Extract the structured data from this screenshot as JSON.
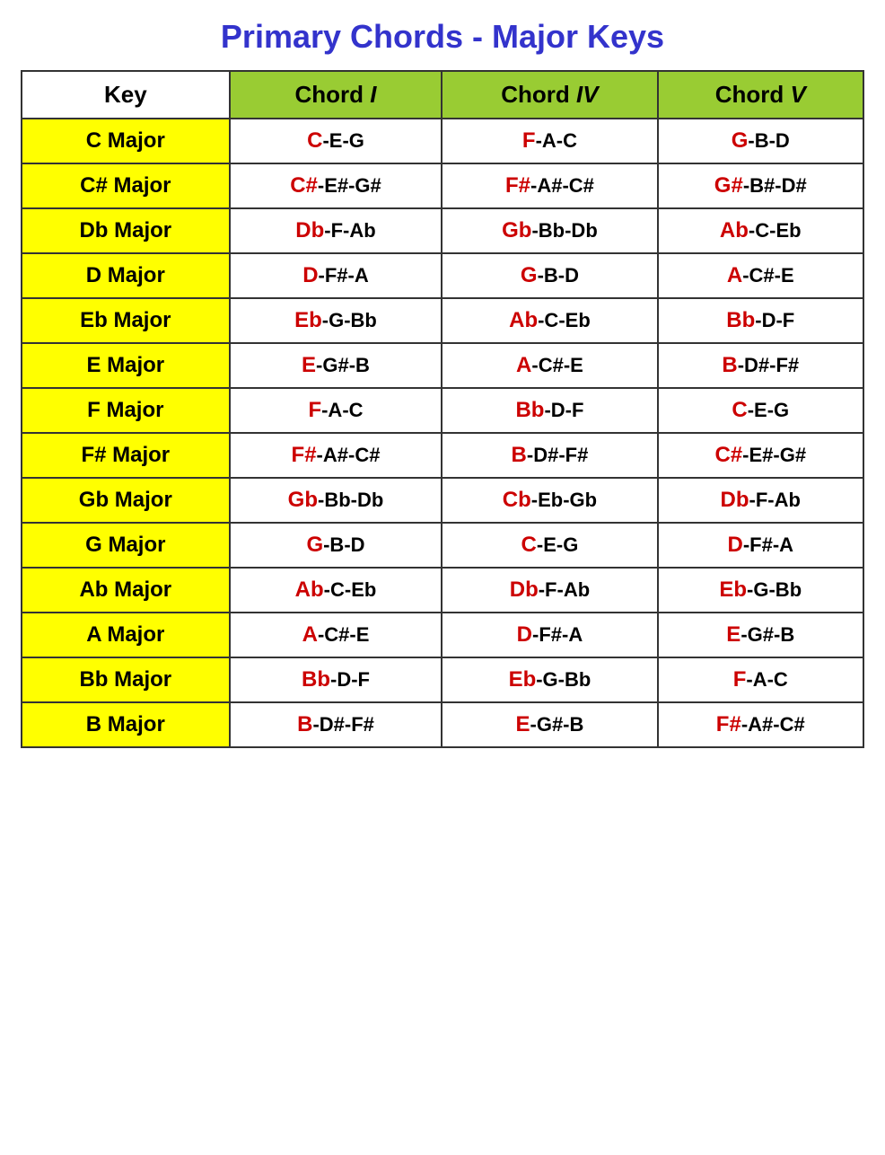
{
  "title": "Primary Chords - Major Keys",
  "headers": {
    "key": "Key",
    "chord1": "Chord",
    "chord1_roman": "I",
    "chord4": "Chord",
    "chord4_roman": "IV",
    "chord5": "Chord",
    "chord5_roman": "V"
  },
  "rows": [
    {
      "key": "C Major",
      "chord1_root": "C",
      "chord1_rest": "-E-G",
      "chord4_root": "F",
      "chord4_rest": "-A-C",
      "chord5_root": "G",
      "chord5_rest": "-B-D"
    },
    {
      "key": "C# Major",
      "chord1_root": "C#",
      "chord1_rest": "-E#-G#",
      "chord4_root": "F#",
      "chord4_rest": "-A#-C#",
      "chord5_root": "G#",
      "chord5_rest": "-B#-D#"
    },
    {
      "key": "Db Major",
      "chord1_root": "Db",
      "chord1_rest": "-F-Ab",
      "chord4_root": "Gb",
      "chord4_rest": "-Bb-Db",
      "chord5_root": "Ab",
      "chord5_rest": "-C-Eb"
    },
    {
      "key": "D Major",
      "chord1_root": "D",
      "chord1_rest": "-F#-A",
      "chord4_root": "G",
      "chord4_rest": "-B-D",
      "chord5_root": "A",
      "chord5_rest": "-C#-E"
    },
    {
      "key": "Eb Major",
      "chord1_root": "Eb",
      "chord1_rest": "-G-Bb",
      "chord4_root": "Ab",
      "chord4_rest": "-C-Eb",
      "chord5_root": "Bb",
      "chord5_rest": "-D-F"
    },
    {
      "key": "E Major",
      "chord1_root": "E",
      "chord1_rest": "-G#-B",
      "chord4_root": "A",
      "chord4_rest": "-C#-E",
      "chord5_root": "B",
      "chord5_rest": "-D#-F#"
    },
    {
      "key": "F Major",
      "chord1_root": "F",
      "chord1_rest": "-A-C",
      "chord4_root": "Bb",
      "chord4_rest": "-D-F",
      "chord5_root": "C",
      "chord5_rest": "-E-G"
    },
    {
      "key": "F# Major",
      "chord1_root": "F#",
      "chord1_rest": "-A#-C#",
      "chord4_root": "B",
      "chord4_rest": "-D#-F#",
      "chord5_root": "C#",
      "chord5_rest": "-E#-G#"
    },
    {
      "key": "Gb Major",
      "chord1_root": "Gb",
      "chord1_rest": "-Bb-Db",
      "chord4_root": "Cb",
      "chord4_rest": "-Eb-Gb",
      "chord5_root": "Db",
      "chord5_rest": "-F-Ab"
    },
    {
      "key": "G Major",
      "chord1_root": "G",
      "chord1_rest": "-B-D",
      "chord4_root": "C",
      "chord4_rest": "-E-G",
      "chord5_root": "D",
      "chord5_rest": "-F#-A"
    },
    {
      "key": "Ab Major",
      "chord1_root": "Ab",
      "chord1_rest": "-C-Eb",
      "chord4_root": "Db",
      "chord4_rest": "-F-Ab",
      "chord5_root": "Eb",
      "chord5_rest": "-G-Bb"
    },
    {
      "key": "A Major",
      "chord1_root": "A",
      "chord1_rest": "-C#-E",
      "chord4_root": "D",
      "chord4_rest": "-F#-A",
      "chord5_root": "E",
      "chord5_rest": "-G#-B"
    },
    {
      "key": "Bb Major",
      "chord1_root": "Bb",
      "chord1_rest": "-D-F",
      "chord4_root": "Eb",
      "chord4_rest": "-G-Bb",
      "chord5_root": "F",
      "chord5_rest": "-A-C"
    },
    {
      "key": "B Major",
      "chord1_root": "B",
      "chord1_rest": "-D#-F#",
      "chord4_root": "E",
      "chord4_rest": "-G#-B",
      "chord5_root": "F#",
      "chord5_rest": "-A#-C#"
    }
  ]
}
